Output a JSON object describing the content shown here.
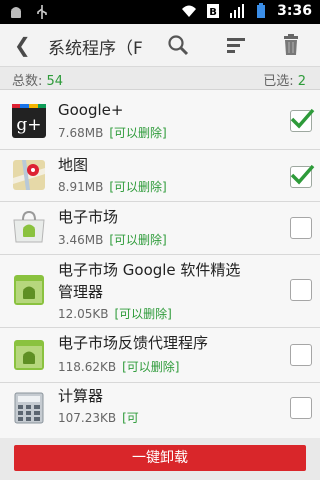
{
  "status_bar": {
    "time": "3:36",
    "icons": [
      "android-icon",
      "usb-icon",
      "wifi-icon",
      "notification-b-icon",
      "signal-icon",
      "battery-icon"
    ]
  },
  "title_bar": {
    "back_icon": "chevron-left-icon",
    "title": "系统程序（F",
    "actions": [
      "search-icon",
      "sort-icon",
      "trash-icon"
    ]
  },
  "counts": {
    "total_label": "总数:",
    "total_value": "54",
    "selected_label": "已选:",
    "selected_value": "2"
  },
  "apps": [
    {
      "name": "Google+",
      "size": "7.68MB",
      "tag": "[可以删除]",
      "checked": true,
      "icon": "google-plus-icon"
    },
    {
      "name": "地图",
      "size": "8.91MB",
      "tag": "[可以删除]",
      "checked": true,
      "icon": "maps-icon"
    },
    {
      "name": "电子市场",
      "size": "3.46MB",
      "tag": "[可以删除]",
      "checked": false,
      "icon": "market-icon"
    },
    {
      "name": "电子市场 Google 软件精选",
      "name2": "管理器",
      "size": "12.05KB",
      "tag": "[可以删除]",
      "checked": false,
      "icon": "android-app-icon"
    },
    {
      "name": "电子市场反馈代理程序",
      "size": "118.62KB",
      "tag": "[可以删除]",
      "checked": false,
      "icon": "android-app-icon"
    },
    {
      "name": "计算器",
      "size": "107.23KB",
      "tag": "[可",
      "checked": false,
      "icon": "calculator-icon"
    }
  ],
  "bottom": {
    "button_label": "一键卸载"
  },
  "colors": {
    "accent_green": "#2e9b3a",
    "uninstall_red": "#d9262a"
  }
}
